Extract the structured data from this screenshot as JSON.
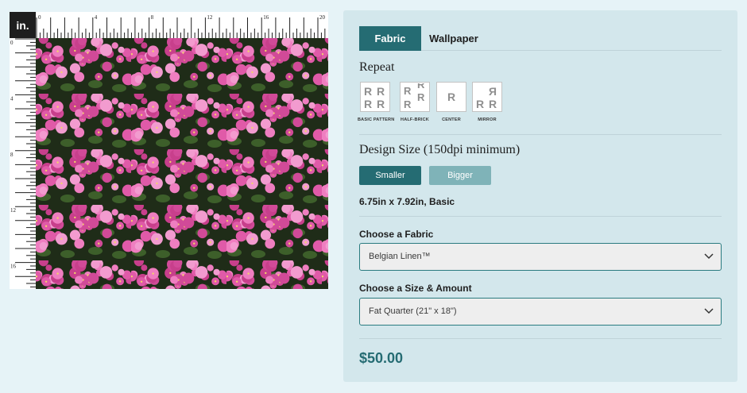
{
  "preview": {
    "unit": "in.",
    "top_ruler_labels": [
      "0",
      "4",
      "8",
      "12",
      "16",
      "20"
    ],
    "left_ruler_labels": [
      "0",
      "4",
      "8",
      "12",
      "16"
    ]
  },
  "tabs": {
    "fabric": "Fabric",
    "wallpaper": "Wallpaper",
    "active": "Fabric"
  },
  "repeat": {
    "title": "Repeat",
    "options": [
      {
        "label": "BASIC PATTERN",
        "glyph": "R"
      },
      {
        "label": "HALF-BRICK",
        "glyph": "R"
      },
      {
        "label": "CENTER",
        "glyph": "R"
      },
      {
        "label": "MIRROR",
        "glyph": "R"
      }
    ]
  },
  "design_size": {
    "title": "Design Size (150dpi minimum)",
    "smaller": "Smaller",
    "bigger": "Bigger",
    "current": "6.75in x 7.92in, Basic"
  },
  "fabric": {
    "label": "Choose a Fabric",
    "value": "Belgian Linen™"
  },
  "amount": {
    "label": "Choose a Size & Amount",
    "value": "Fat Quarter (21\" x 18\")"
  },
  "price": "$50.00",
  "colors": {
    "accent": "#256c73",
    "accent_light": "#7fb3b8",
    "panel": "#d3e7ec",
    "background": "#e6f3f7",
    "flower": "#e05aa8"
  }
}
